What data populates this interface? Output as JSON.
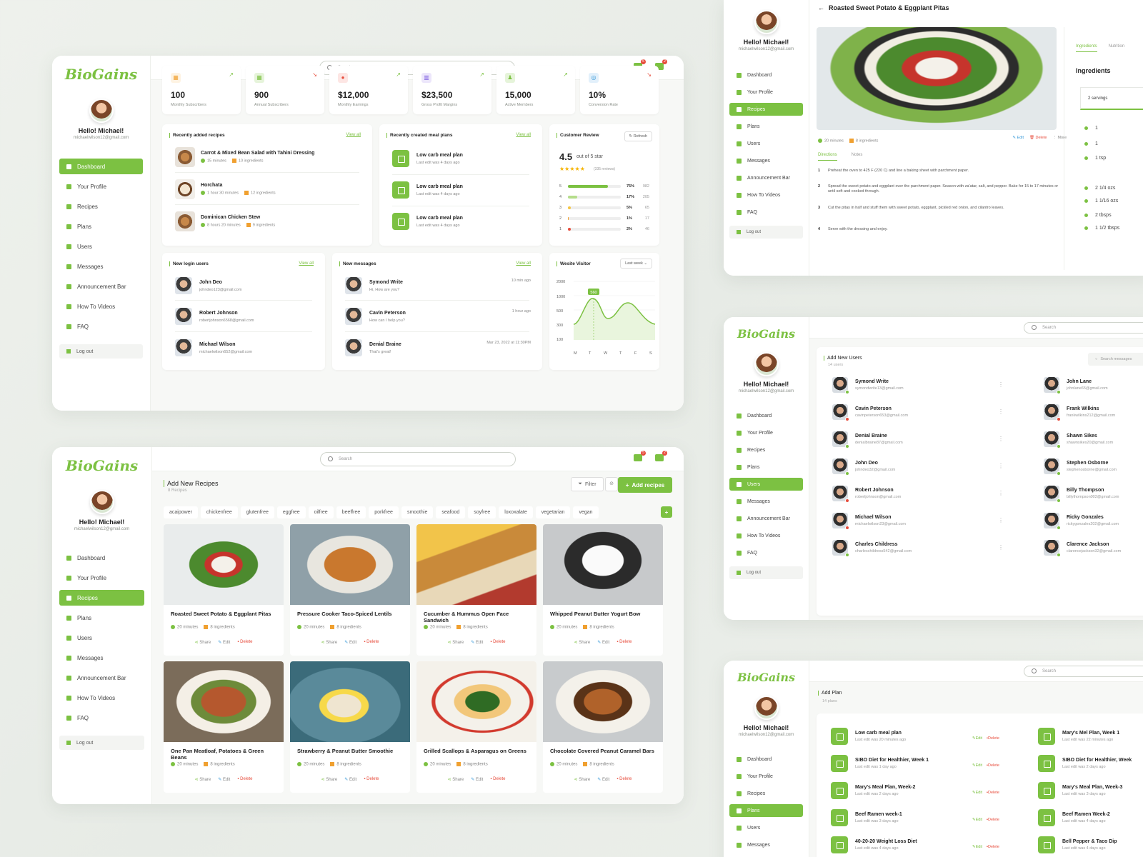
{
  "brand": {
    "logo": "BioGains",
    "hello": "Hello! Michael!",
    "email": "michaelwilson12@gmail.com",
    "accent": "#7cc142",
    "danger": "#e74c3c"
  },
  "nav": {
    "items": [
      "Dashboard",
      "Your Profile",
      "Recipes",
      "Plans",
      "Users",
      "Messages",
      "Announcement Bar",
      "How To Videos",
      "FAQ"
    ],
    "logout": "Log out"
  },
  "search": {
    "placeholder": "Search"
  },
  "notifications": {
    "mail": "5",
    "bell": "2"
  },
  "dashboard": {
    "stats": [
      {
        "value": "100",
        "label": "Monthly Subscribers",
        "trend": "up"
      },
      {
        "value": "900",
        "label": "Annual Subscribers",
        "trend": "down"
      },
      {
        "value": "$12,000",
        "label": "Monthly Earnings",
        "trend": "up"
      },
      {
        "value": "$23,500",
        "label": "Gross Profit Margins",
        "trend": "up"
      },
      {
        "value": "15,000",
        "label": "Active Members",
        "trend": "up"
      },
      {
        "value": "10%",
        "label": "Conversion Rate",
        "trend": "down"
      }
    ],
    "recent_recipes": {
      "title": "Recently added recipes",
      "view_all": "View all",
      "items": [
        {
          "name": "Carrot & Mixed Bean Salad with Tahini Dressing",
          "time": "15 minutes",
          "ing": "10 ingredients"
        },
        {
          "name": "Horchata",
          "time": "1 hour 30 minutes",
          "ing": "12 ingredients"
        },
        {
          "name": "Dominican Chicken Stew",
          "time": "8 hours 20 minutes",
          "ing": "9 ingredients"
        }
      ]
    },
    "meal_plans": {
      "title": "Recently created meal plans",
      "view_all": "View all",
      "items": [
        {
          "name": "Low carb meal plan",
          "sub": "Last edit was 4 days ago"
        },
        {
          "name": "Low carb meal plan",
          "sub": "Last edit was 4 days ago"
        },
        {
          "name": "Low carb meal plan",
          "sub": "Last edit was 4 days ago"
        }
      ]
    },
    "review": {
      "title": "Customer Review",
      "refresh": "Refresh",
      "score": "4.5",
      "out_of": "out of 5 star",
      "count": "(335 reviews)",
      "bars": [
        {
          "star": "5",
          "pct": "75%",
          "count": "982",
          "fill": 0.75,
          "color": "#7cc142"
        },
        {
          "star": "4",
          "pct": "17%",
          "count": "205",
          "fill": 0.17,
          "color": "#b5dd8b"
        },
        {
          "star": "3",
          "pct": "5%",
          "count": "65",
          "fill": 0.05,
          "color": "#f5c542"
        },
        {
          "star": "2",
          "pct": "1%",
          "count": "17",
          "fill": 0.02,
          "color": "#f0a030"
        },
        {
          "star": "1",
          "pct": "2%",
          "count": "46",
          "fill": 0.06,
          "color": "#e74c3c"
        }
      ]
    },
    "login_users": {
      "title": "New login users",
      "view_all": "View all",
      "items": [
        {
          "name": "John Deo",
          "email": "johndeo123@gmail.com"
        },
        {
          "name": "Robert Johnson",
          "email": "robertjohnson6568@gmail.com"
        },
        {
          "name": "Michael Wilson",
          "email": "michaelwilson652@gmail.com"
        }
      ]
    },
    "messages": {
      "title": "New messages",
      "view_all": "View all",
      "items": [
        {
          "name": "Symond Write",
          "text": "Hi, How are you?",
          "time": "10 min ago"
        },
        {
          "name": "Cavin Peterson",
          "text": "How can I help you?",
          "time": "1 hour ago"
        },
        {
          "name": "Denial Braine",
          "text": "That's great!",
          "time": "Mar 23, 2022 at 11:30PM"
        }
      ]
    },
    "visitor": {
      "title": "Wesite Visitor",
      "range": "Last week",
      "yticks": [
        "2000",
        "1000",
        "500",
        "300",
        "100"
      ],
      "days": [
        "M",
        "T",
        "W",
        "T",
        "F",
        "S"
      ],
      "marker": "560"
    }
  },
  "recipes_page": {
    "title": "Add New Recipes",
    "count": "8 Recipes",
    "filter": "Filter",
    "add": "Add recipes",
    "tags": [
      "acaipower",
      "chickenfree",
      "glutenfree",
      "eggfree",
      "oilfree",
      "beeffree",
      "porkfree",
      "smoothie",
      "seafood",
      "soyfree",
      "loxoxalate",
      "vegetarian",
      "vegan"
    ],
    "cards": [
      {
        "name": "Roasted Sweet Potato & Eggplant Pitas",
        "time": "20 minutes",
        "ing": "8 ingredients"
      },
      {
        "name": "Pressure Cooker Taco-Spiced Lentils",
        "time": "20 minutes",
        "ing": "8 ingredients"
      },
      {
        "name": "Cucumber & Hummus Open Face Sandwich",
        "time": "20 minutes",
        "ing": "8 ingredients"
      },
      {
        "name": "Whipped Peanut Butter Yogurt Bow",
        "time": "20 minutes",
        "ing": "8 ingredients"
      },
      {
        "name": "One Pan Meatloaf, Potatoes & Green Beans",
        "time": "20 minutes",
        "ing": "8 ingredients"
      },
      {
        "name": "Strawberry & Peanut Butter Smoothie",
        "time": "20 minutes",
        "ing": "8 ingredients"
      },
      {
        "name": "Grilled Scallops & Asparagus on Greens",
        "time": "20 minutes",
        "ing": "8 ingredients"
      },
      {
        "name": "Chocolate Covered Peanut Caramel Bars",
        "time": "20 minutes",
        "ing": "8 ingredients"
      }
    ],
    "actions": {
      "share": "Share",
      "edit": "Edit",
      "delete": "Delete"
    }
  },
  "detail_page": {
    "back_title": "Roasted Sweet Potato & Eggplant Pitas",
    "time": "20 minutes",
    "ing": "8 ingredients",
    "edit": "Edit",
    "delete": "Delete",
    "more": "More",
    "tabs": [
      "Directions",
      "Notes"
    ],
    "steps": [
      "Preheat the oven to 425 F (220 C) and line a baking sheet with parchment paper.",
      "Spread the sweet potato and eggplant over the parchment paper. Season with za'atar, salt, and pepper. Bake for 15 to 17 minutes or until soft and cooked through.",
      "Cut the pitas in half and stuff them with sweet potato, eggplant, pickled red onion, and cilantro leaves.",
      "Serve with the dressing and enjoy."
    ],
    "right_tabs": [
      "Ingredients",
      "Nutrition"
    ],
    "ing_title": "Ingredients",
    "servings": "2 servings",
    "ingredients": [
      "1",
      "1",
      "1 tsp",
      "2 1/4 ozs",
      "1 1/16 ozs",
      "2 tbsps",
      "1 1/2 tbsps"
    ]
  },
  "users_page": {
    "title": "Add New Users",
    "count": "14 users",
    "search": "Search messages",
    "left": [
      {
        "name": "Symond Write",
        "email": "symondwrite13@gmail.com",
        "status": "green"
      },
      {
        "name": "Cavin Peterson",
        "email": "cavinpeterson653@gmail.com",
        "status": "red"
      },
      {
        "name": "Denial Braine",
        "email": "denialbraine87@gmail.com",
        "status": "green"
      },
      {
        "name": "John Deo",
        "email": "johndeo32@gmail.com",
        "status": "green"
      },
      {
        "name": "Robert Johnson",
        "email": "robertjohnson@gmail.com",
        "status": "red"
      },
      {
        "name": "Michael Wilson",
        "email": "michaelwilson23@gmail.com",
        "status": "red"
      },
      {
        "name": "Charles Childress",
        "email": "charleschildress542@gmail.com",
        "status": "green"
      }
    ],
    "right": [
      {
        "name": "John Lane",
        "email": "johnlane65@gmail.com",
        "status": "green"
      },
      {
        "name": "Frank Wilkins",
        "email": "frankwilkins212@gmail.com",
        "status": "red"
      },
      {
        "name": "Shawn Sikes",
        "email": "shawnsikes20@gmail.com",
        "status": "green"
      },
      {
        "name": "Stephen Osborne",
        "email": "stephenosborne@gmail.com",
        "status": "green"
      },
      {
        "name": "Billy Thompson",
        "email": "billythompson002@gmail.com",
        "status": "green"
      },
      {
        "name": "Ricky Gonzales",
        "email": "rickygonzales202@gmail.com",
        "status": "green"
      },
      {
        "name": "Clarence Jackson",
        "email": "clarencejackson32@gmail.com",
        "status": "green"
      }
    ]
  },
  "plans_page": {
    "title": "Add Plan",
    "count": "14 plans",
    "left": [
      {
        "name": "Low carb meal plan",
        "sub": "Last edit was 20 minutes ago"
      },
      {
        "name": "SIBO Diet for Healthier, Week 1",
        "sub": "Last edit was 1 day ago"
      },
      {
        "name": "Mary's Meal Plan, Week-2",
        "sub": "Last edit was 2 days ago"
      },
      {
        "name": "Beef Ramen week-1",
        "sub": "Last edit was 3 days ago"
      },
      {
        "name": "40-20-20 Weight Loss Diet",
        "sub": "Last edit was 4 days ago"
      }
    ],
    "right": [
      {
        "name": "Mary's Mel Plan, Week 1",
        "sub": "Last edit was 22 minutes ago"
      },
      {
        "name": "SIBO Diet for Healthier, Week",
        "sub": "Last edit was 2 days ago"
      },
      {
        "name": "Mary's Meal Plan, Week-3",
        "sub": "Last edit was 3 days ago"
      },
      {
        "name": "Beef Ramen Week-2",
        "sub": "Last edit was 4 days ago"
      },
      {
        "name": "Bell Pepper & Taco Dip",
        "sub": "Last edit was 4 days ago"
      }
    ],
    "edit": "Edit",
    "delete": "Delete"
  }
}
